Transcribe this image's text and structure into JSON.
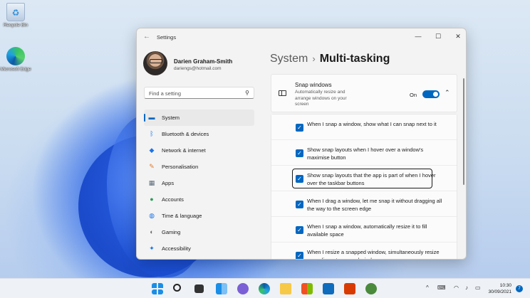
{
  "desktop": {
    "icons": [
      {
        "label": "Recycle Bin"
      },
      {
        "label": "Microsoft Edge"
      }
    ]
  },
  "window": {
    "title": "Settings",
    "controls": {
      "minimize": "—",
      "maximize": "☐",
      "close": "✕"
    }
  },
  "profile": {
    "name": "Darien Graham-Smith",
    "email": "dariengs@hotmail.com"
  },
  "search": {
    "placeholder": "Find a setting"
  },
  "nav": {
    "items": [
      {
        "label": "System",
        "icon": "monitor-icon",
        "color": "#0067c0",
        "active": true
      },
      {
        "label": "Bluetooth & devices",
        "icon": "bluetooth-icon",
        "color": "#1a73e8"
      },
      {
        "label": "Network & internet",
        "icon": "wifi-icon",
        "color": "#1a73e8"
      },
      {
        "label": "Personalisation",
        "icon": "brush-icon",
        "color": "#e07b2d"
      },
      {
        "label": "Apps",
        "icon": "apps-icon",
        "color": "#5b6b7a"
      },
      {
        "label": "Accounts",
        "icon": "person-icon",
        "color": "#2c9c5a"
      },
      {
        "label": "Time & language",
        "icon": "globe-clock-icon",
        "color": "#1a73e8"
      },
      {
        "label": "Gaming",
        "icon": "gamepad-icon",
        "color": "#6b6b6b"
      },
      {
        "label": "Accessibility",
        "icon": "accessibility-icon",
        "color": "#1a73e8"
      }
    ]
  },
  "breadcrumb": {
    "parent": "System",
    "separator": "›",
    "current": "Multi-tasking"
  },
  "snap": {
    "title": "Snap windows",
    "description": "Automatically resize and arrange windows on your screen",
    "toggle_label": "On",
    "toggle_on": true,
    "options": [
      {
        "text": "When I snap a window, show what I can snap next to it",
        "checked": true
      },
      {
        "text": "Show snap layouts when I hover over a window's maximise button",
        "checked": true
      },
      {
        "text": "Show snap layouts that the app is part of when I hover over the taskbar buttons",
        "checked": true,
        "focused": true
      },
      {
        "text": "When I drag a window, let me snap it without dragging all the way to the screen edge",
        "checked": true
      },
      {
        "text": "When I snap a window, automatically resize it to fill available space",
        "checked": true
      },
      {
        "text": "When I resize a snapped window, simultaneously resize any adjacent snapped window",
        "checked": true
      }
    ]
  },
  "taskbar": {
    "time": "10:30",
    "date": "30/09/2021",
    "notifications": "7",
    "tray_arrow": "^"
  },
  "colors": {
    "accent": "#0067c0"
  }
}
